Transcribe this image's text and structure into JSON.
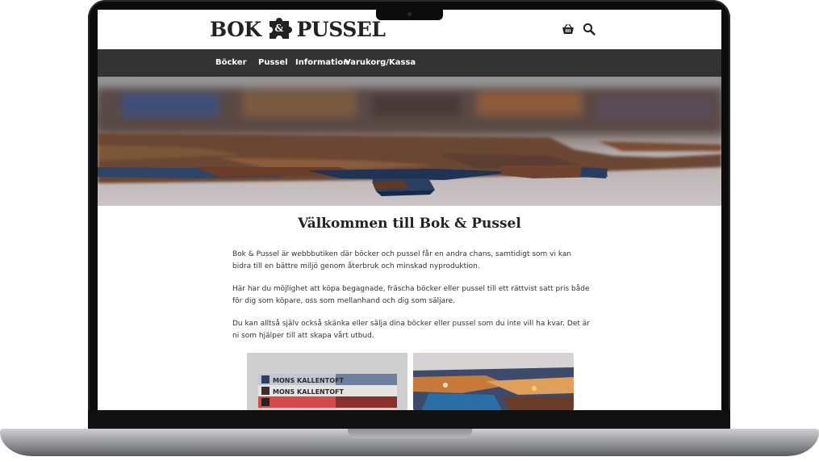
{
  "site": {
    "logo_left": "BOK",
    "logo_amp": "&",
    "logo_right": "PUSSEL"
  },
  "header": {
    "icons": [
      "basket-icon",
      "search-icon"
    ]
  },
  "nav": {
    "items": [
      {
        "label": "Böcker"
      },
      {
        "label": "Pussel"
      },
      {
        "label": "Information"
      },
      {
        "label": "Varukorg/Kassa"
      }
    ]
  },
  "main": {
    "title": "Välkommen till Bok & Pussel",
    "paragraphs": [
      "Bok & Pussel är webbbutiken där böcker och pussel får en andra chans, samtidigt som vi kan bidra till en bättre miljö genom återbruk och minskad nyproduktion.",
      "Här har du möjlighet att köpa begagnade, fräscha böcker eller pussel till ett rättvist satt pris både för dig som köpare, oss som mellanhand och dig som säljare.",
      "Du kan alltså själv också skänka eller sälja dina böcker eller pussel som du inte vill ha kvar. Det är ni som hjälper till att skapa vårt utbud."
    ],
    "book_spines": [
      "MONS KALLENTOFT",
      "MONS KALLENTOFT"
    ]
  },
  "colors": {
    "nav_bg": "#333333",
    "text": "#222222",
    "frame": "#0c0c0c"
  }
}
